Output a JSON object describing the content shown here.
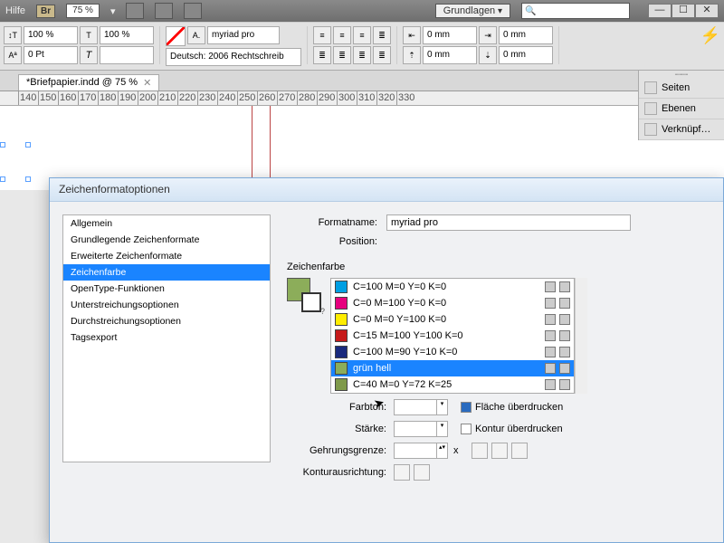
{
  "menubar": {
    "help": "Hilfe",
    "br": "Br",
    "zoom": "75 %",
    "workspace": "Grundlagen",
    "win_min": "—",
    "win_max": "☐",
    "win_close": "✕"
  },
  "ctrlbar": {
    "scale_x": "100 %",
    "scale_y": "100 %",
    "leading": "0 Pt",
    "font_family": "myriad pro",
    "language": "Deutsch: 2006 Rechtschreib",
    "inset_left": "0 mm",
    "inset_right": "0 mm",
    "inset_top": "0 mm",
    "inset_bottom": "0 mm",
    "lightning": "⚡"
  },
  "document": {
    "tab_title": "*Briefpapier.indd @ 75 %",
    "ruler": [
      "140",
      "150",
      "160",
      "170",
      "180",
      "190",
      "200",
      "210",
      "220",
      "230",
      "240",
      "250",
      "260",
      "270",
      "280",
      "290",
      "300",
      "310",
      "320",
      "330"
    ]
  },
  "panels": {
    "items": [
      {
        "label": "Seiten",
        "icon": "pages"
      },
      {
        "label": "Ebenen",
        "icon": "layers"
      },
      {
        "label": "Verknüpf…",
        "icon": "links"
      }
    ]
  },
  "dialog": {
    "title": "Zeichenformatoptionen",
    "categories": [
      "Allgemein",
      "Grundlegende Zeichenformate",
      "Erweiterte Zeichenformate",
      "Zeichenfarbe",
      "OpenType-Funktionen",
      "Unterstreichungsoptionen",
      "Durchstreichungsoptionen",
      "Tagsexport"
    ],
    "selected_category_index": 3,
    "formatname_label": "Formatname:",
    "formatname_value": "myriad pro",
    "position_label": "Position:",
    "section_title": "Zeichenfarbe",
    "swatches": [
      {
        "name": "C=100 M=0 Y=0 K=0",
        "color": "#009fe3"
      },
      {
        "name": "C=0 M=100 Y=0 K=0",
        "color": "#e6007e"
      },
      {
        "name": "C=0 M=0 Y=100 K=0",
        "color": "#ffed00"
      },
      {
        "name": "C=15 M=100 Y=100 K=0",
        "color": "#c61a1a"
      },
      {
        "name": "C=100 M=90 Y=10 K=0",
        "color": "#1a2a7d"
      },
      {
        "name": "grün hell",
        "color": "#8cad5a"
      },
      {
        "name": "C=40 M=0 Y=72 K=25",
        "color": "#7f9a4a"
      }
    ],
    "selected_swatch_index": 5,
    "tint_label": "Farbton:",
    "weight_label": "Stärke:",
    "miter_label": "Gehrungsgrenze:",
    "miter_x": "x",
    "align_label": "Konturausrichtung:",
    "overprint_fill": "Fläche überdrucken",
    "overprint_stroke": "Kontur überdrucken",
    "fill_color": "#8cad5a"
  }
}
